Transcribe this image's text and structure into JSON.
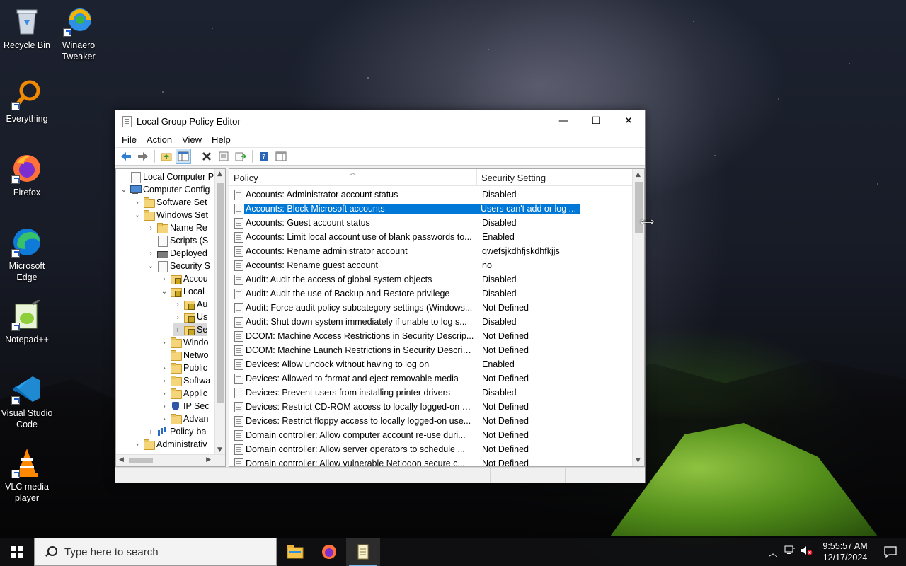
{
  "desktop": {
    "icons": [
      {
        "label": "Recycle Bin"
      },
      {
        "label": "Winaero Tweaker"
      },
      {
        "label": "Everything"
      },
      {
        "label": "Firefox"
      },
      {
        "label": "Microsoft Edge"
      },
      {
        "label": "Notepad++"
      },
      {
        "label": "Visual Studio Code"
      },
      {
        "label": "VLC media player"
      }
    ]
  },
  "window": {
    "title": "Local Group Policy Editor",
    "controls": {
      "minimize": "—",
      "maximize": "☐",
      "close": "✕"
    },
    "menu": [
      "File",
      "Action",
      "View",
      "Help"
    ],
    "tree": [
      {
        "label": "Local Computer Pol",
        "expander": "",
        "icon": "doc"
      },
      {
        "label": "Computer Config",
        "expander": "⌄",
        "icon": "pc"
      },
      {
        "label": "Software Set",
        "expander": "›",
        "icon": "folder"
      },
      {
        "label": "Windows Set",
        "expander": "⌄",
        "icon": "folder"
      },
      {
        "label": "Name Re",
        "expander": "›",
        "icon": "folder"
      },
      {
        "label": "Scripts (S",
        "expander": "",
        "icon": "doc"
      },
      {
        "label": "Deployed",
        "expander": "›",
        "icon": "printer"
      },
      {
        "label": "Security S",
        "expander": "⌄",
        "icon": "doc"
      },
      {
        "label": "Accou",
        "expander": "›",
        "icon": "lockfolder"
      },
      {
        "label": "Local",
        "expander": "⌄",
        "icon": "lockfolder"
      },
      {
        "label": "Au",
        "expander": "›",
        "icon": "lockfolder"
      },
      {
        "label": "Us",
        "expander": "›",
        "icon": "lockfolder"
      },
      {
        "label": "Se",
        "expander": "›",
        "icon": "lockfolder"
      },
      {
        "label": "Windo",
        "expander": "›",
        "icon": "folder"
      },
      {
        "label": "Netwo",
        "expander": "",
        "icon": "folder"
      },
      {
        "label": "Public",
        "expander": "›",
        "icon": "folder"
      },
      {
        "label": "Softwa",
        "expander": "›",
        "icon": "folder"
      },
      {
        "label": "Applic",
        "expander": "›",
        "icon": "folder"
      },
      {
        "label": "IP Sec",
        "expander": "›",
        "icon": "shield"
      },
      {
        "label": "Advan",
        "expander": "›",
        "icon": "folder"
      },
      {
        "label": "Policy-ba",
        "expander": "›",
        "icon": "chart"
      },
      {
        "label": "Administrativ",
        "expander": "›",
        "icon": "folder"
      }
    ],
    "list": {
      "columns": {
        "policy": "Policy",
        "setting": "Security Setting"
      },
      "rows": [
        {
          "policy": "Accounts: Administrator account status",
          "setting": "Disabled"
        },
        {
          "policy": "Accounts: Block Microsoft accounts",
          "setting": "Users can't add or log ..."
        },
        {
          "policy": "Accounts: Guest account status",
          "setting": "Disabled"
        },
        {
          "policy": "Accounts: Limit local account use of blank passwords to...",
          "setting": "Enabled"
        },
        {
          "policy": "Accounts: Rename administrator account",
          "setting": "qwefsjkdhfjskdhfkjjs"
        },
        {
          "policy": "Accounts: Rename guest account",
          "setting": "no"
        },
        {
          "policy": "Audit: Audit the access of global system objects",
          "setting": "Disabled"
        },
        {
          "policy": "Audit: Audit the use of Backup and Restore privilege",
          "setting": "Disabled"
        },
        {
          "policy": "Audit: Force audit policy subcategory settings (Windows...",
          "setting": "Not Defined"
        },
        {
          "policy": "Audit: Shut down system immediately if unable to log s...",
          "setting": "Disabled"
        },
        {
          "policy": "DCOM: Machine Access Restrictions in Security Descrip...",
          "setting": "Not Defined"
        },
        {
          "policy": "DCOM: Machine Launch Restrictions in Security Descrip...",
          "setting": "Not Defined"
        },
        {
          "policy": "Devices: Allow undock without having to log on",
          "setting": "Enabled"
        },
        {
          "policy": "Devices: Allowed to format and eject removable media",
          "setting": "Not Defined"
        },
        {
          "policy": "Devices: Prevent users from installing printer drivers",
          "setting": "Disabled"
        },
        {
          "policy": "Devices: Restrict CD-ROM access to locally logged-on u...",
          "setting": "Not Defined"
        },
        {
          "policy": "Devices: Restrict floppy access to locally logged-on use...",
          "setting": "Not Defined"
        },
        {
          "policy": "Domain controller: Allow computer account re-use duri...",
          "setting": "Not Defined"
        },
        {
          "policy": "Domain controller: Allow server operators to schedule ...",
          "setting": "Not Defined"
        },
        {
          "policy": "Domain controller: Allow vulnerable Netlogon secure c...",
          "setting": "Not Defined"
        }
      ]
    }
  },
  "taskbar": {
    "search_placeholder": "Type here to search",
    "time": "9:55:57 AM",
    "date": "12/17/2024"
  }
}
